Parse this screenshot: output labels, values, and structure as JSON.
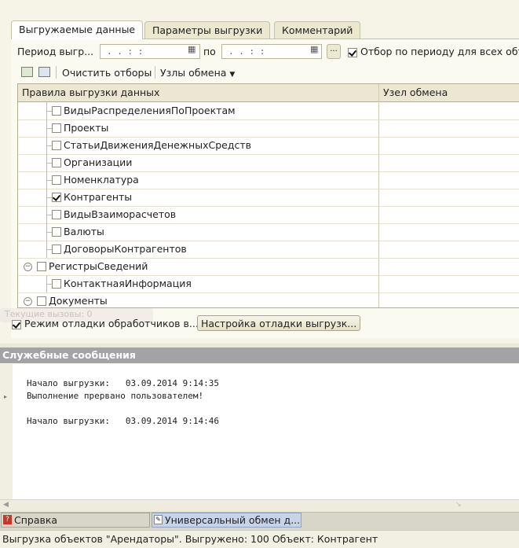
{
  "tabs": [
    "Выгружаемые данные",
    "Параметры выгрузки",
    "Комментарий"
  ],
  "period": {
    "label": "Период выгр...",
    "from_value": " .  .     :  :",
    "to_label": "по",
    "to_value": " .  .     :  :",
    "select_btn": "...",
    "filter_all_label": "Отбор по периоду для всех объ",
    "filter_all_checked": true
  },
  "toolbar": {
    "clear_filters": "Очистить отборы",
    "exchange_nodes": "Узлы обмена"
  },
  "table": {
    "columns": [
      "Правила выгрузки данных",
      "Узел обмена"
    ],
    "rows": [
      {
        "label": "ВидыРаспределенияПоПроектам",
        "checked": false,
        "level": 2
      },
      {
        "label": "Проекты",
        "checked": false,
        "level": 2
      },
      {
        "label": "СтатьиДвиженияДенежныхСредств",
        "checked": false,
        "level": 2
      },
      {
        "label": "Организации",
        "checked": false,
        "level": 2
      },
      {
        "label": "Номенклатура",
        "checked": false,
        "level": 2
      },
      {
        "label": "Контрагенты",
        "checked": true,
        "level": 2
      },
      {
        "label": "ВидыВзаиморасчетов",
        "checked": false,
        "level": 2
      },
      {
        "label": "Валюты",
        "checked": false,
        "level": 2
      },
      {
        "label": "ДоговорыКонтрагентов",
        "checked": false,
        "level": 2
      },
      {
        "label": "РегистрыСведений",
        "checked": false,
        "level": 1,
        "group": true
      },
      {
        "label": "КонтактнаяИнформация",
        "checked": false,
        "level": 2
      },
      {
        "label": "Документы",
        "checked": false,
        "level": 1,
        "group": true
      }
    ]
  },
  "overlay_hint": "Текущие вызовы: 0",
  "debug": {
    "mode_label": "Режим отладки обработчиков в...",
    "mode_checked": true,
    "settings_button": "Настройка отладки выгрузк..."
  },
  "messages": {
    "title": "Служебные сообщения",
    "lines": [
      "Начало выгрузки:   03.09.2014 9:14:35",
      "Выполнение прервано пользователем!",
      "",
      "Начало выгрузки:   03.09.2014 9:14:46"
    ]
  },
  "taskbar": {
    "help": "Справка",
    "universal": "Универсальный обмен д..."
  },
  "status": "Выгрузка объектов \"Арендаторы\". Выгружено: 100 Объект: Контрагент",
  "colors": {
    "panel_bg": "#f5f4e6",
    "header_gray": "#a3a3a3",
    "active_task": "#c7d4e8"
  }
}
